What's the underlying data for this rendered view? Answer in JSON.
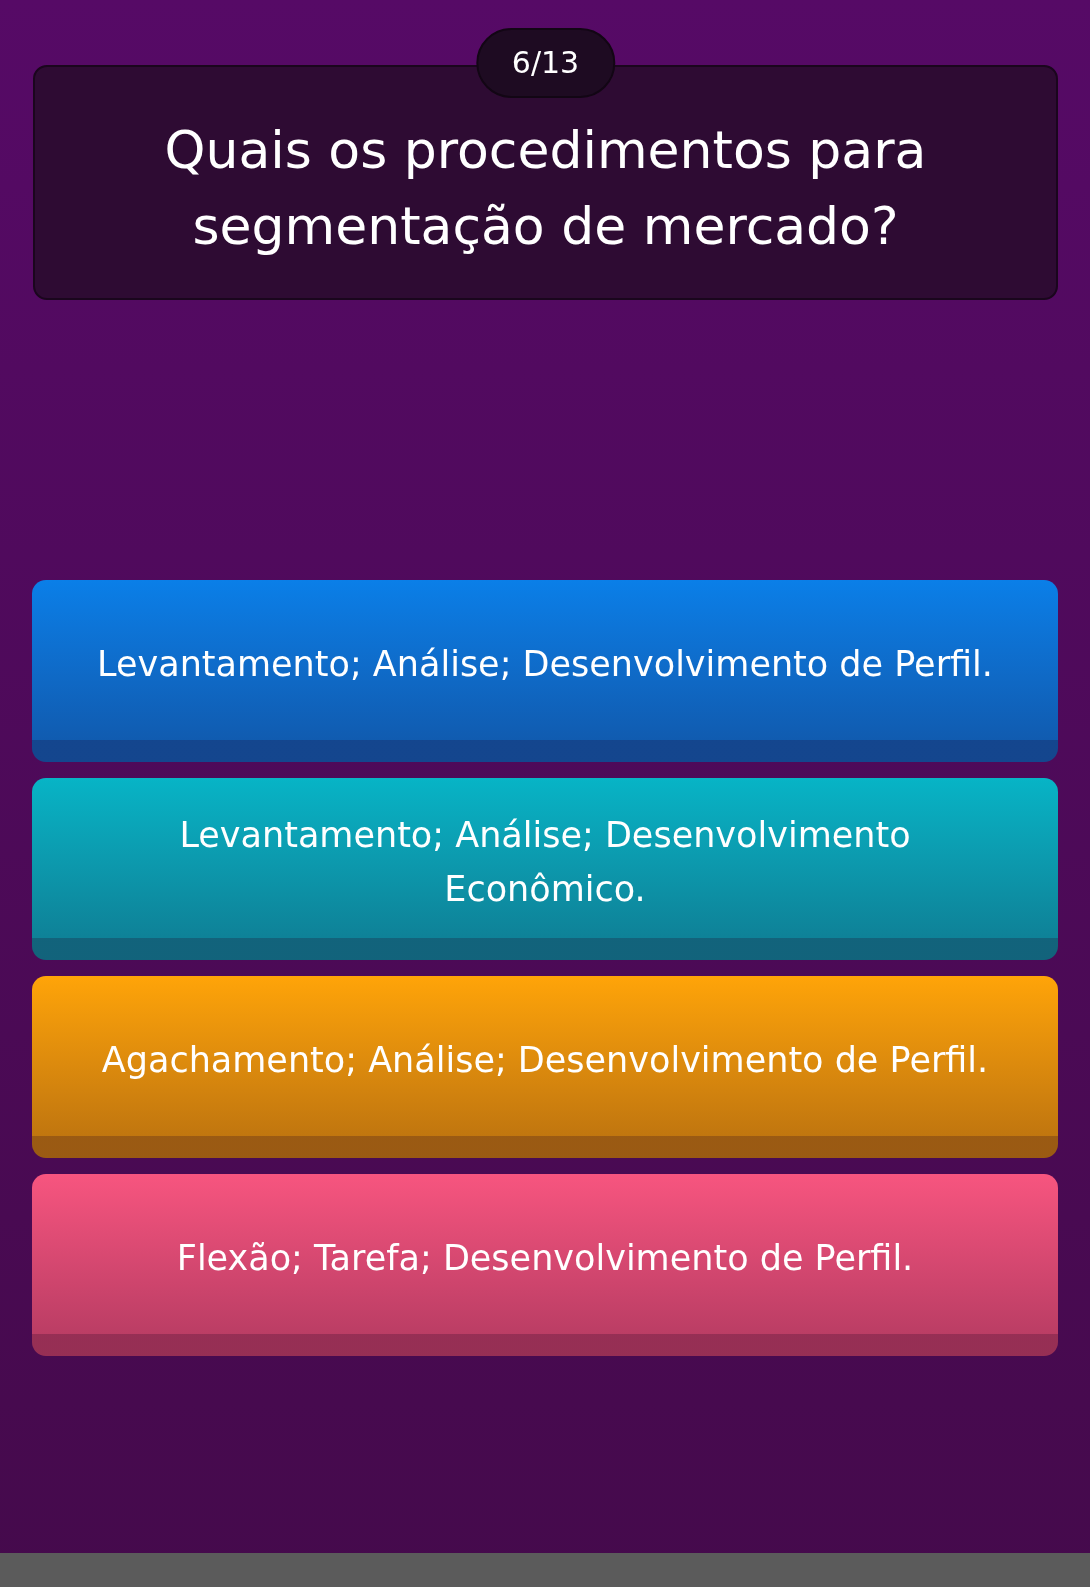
{
  "counter": "6/13",
  "question": "Quais os procedimentos para segmentação de mercado?",
  "answers": [
    {
      "text": "Levantamento; Análise; Desenvolvimento de Perfil.",
      "color": "#0a7fe8"
    },
    {
      "text": "Levantamento; Análise; Desenvolvimento Econômico.",
      "color": "#07b4c6"
    },
    {
      "text": "Agachamento; Análise; Desenvolvimento de Perfil.",
      "color": "#ffa408"
    },
    {
      "text": "Flexão; Tarefa; Desenvolvimento de Perfil.",
      "color": "#f7557f"
    }
  ]
}
